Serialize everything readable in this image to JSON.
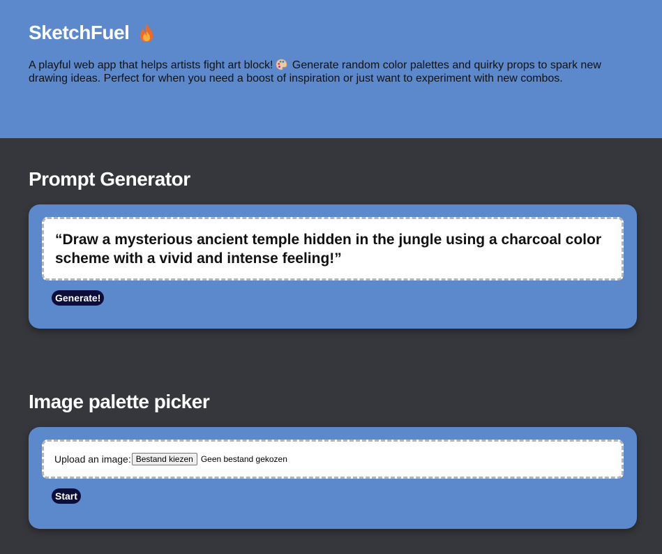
{
  "header": {
    "title": "SketchFuel",
    "title_icon": "flame-icon",
    "tagline_part1": "A playful web app that helps artists fight art block!",
    "tagline_icon": "palette-icon",
    "tagline_part2": "Generate random color palettes and quirky props to spark new drawing ideas. Perfect for when you need a boost of inspiration or just want to experiment with new combos."
  },
  "prompt_generator": {
    "title": "Prompt Generator",
    "prompt": "“Draw a mysterious ancient temple hidden in the jungle using a charcoal color scheme with a vivid and intense feeling!”",
    "button_label": "Generate!"
  },
  "palette_picker": {
    "title": "Image palette picker",
    "upload_label": "Upload an image:",
    "file_button_label": "Bestand kiezen",
    "file_status": "Geen bestand gekozen",
    "button_label": "Start"
  },
  "colors": {
    "accent_blue": "#5b89cb",
    "background": "#36373c",
    "button_dark": "#0d0d3a"
  }
}
